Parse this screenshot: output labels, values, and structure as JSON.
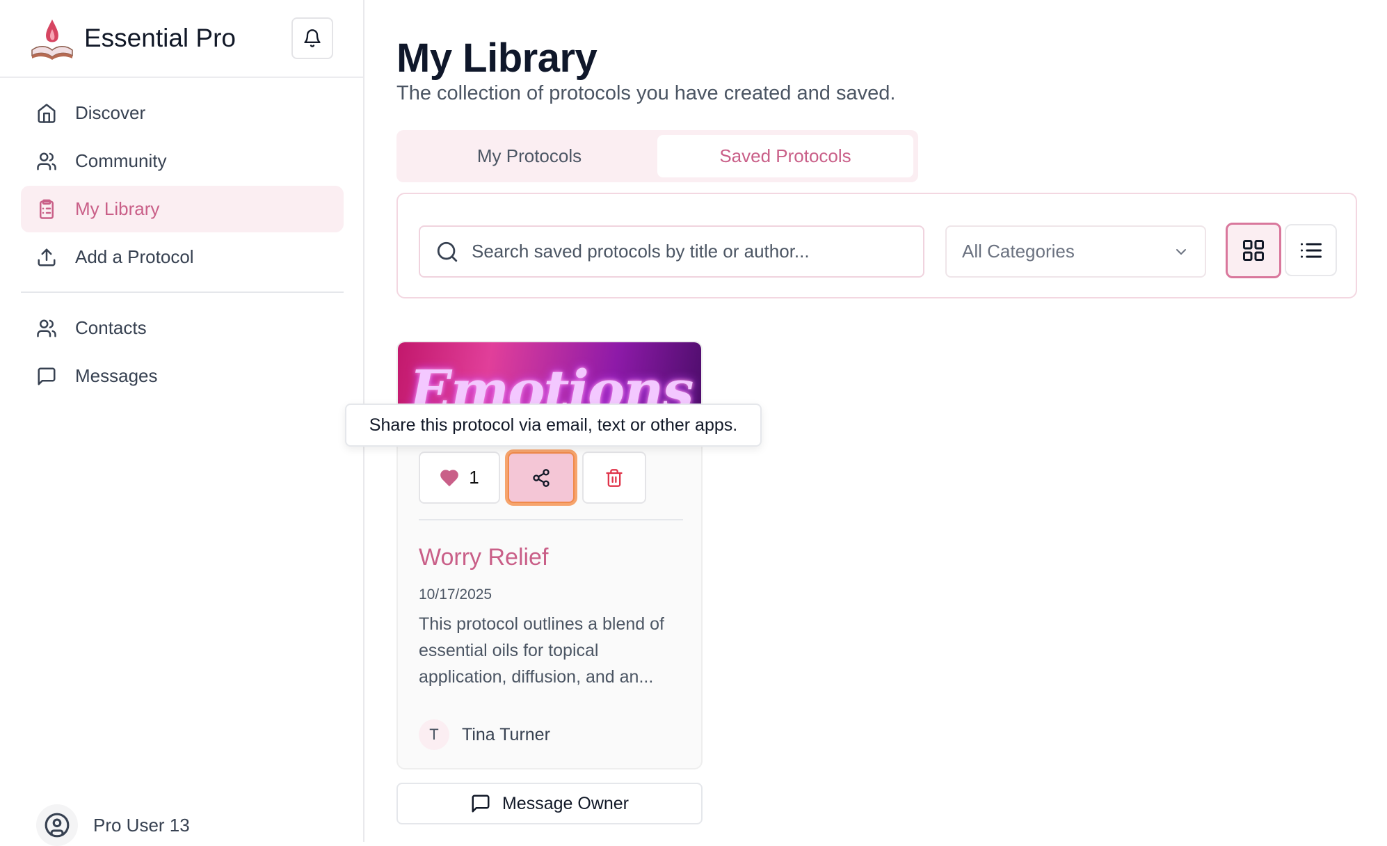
{
  "app": {
    "name": "Essential Pro"
  },
  "sidebar": {
    "items": [
      {
        "label": "Discover",
        "icon": "home-icon"
      },
      {
        "label": "Community",
        "icon": "users-icon"
      },
      {
        "label": "My Library",
        "icon": "clipboard-list-icon",
        "active": true
      },
      {
        "label": "Add a Protocol",
        "icon": "upload-icon"
      },
      {
        "label": "Contacts",
        "icon": "users-icon"
      },
      {
        "label": "Messages",
        "icon": "message-square-icon"
      }
    ],
    "user": "Pro User 13"
  },
  "page": {
    "title": "My Library",
    "subtitle": "The collection of protocols you have created and saved."
  },
  "tabs": [
    {
      "label": "My Protocols",
      "active": false
    },
    {
      "label": "Saved Protocols",
      "active": true
    }
  ],
  "filters": {
    "search_placeholder": "Search saved protocols by title or author...",
    "category": "All Categories",
    "view_mode": "grid"
  },
  "card": {
    "banner_text": "Emotions",
    "likes": "1",
    "title": "Worry Relief",
    "date": "10/17/2025",
    "description": "This protocol outlines a blend of essential oils for topical application, diffusion, and an...",
    "author_initial": "T",
    "author": "Tina Turner"
  },
  "tooltip": "Share this protocol via email, text or other apps.",
  "message_owner_label": "Message Owner",
  "colors": {
    "accent": "#c95f88",
    "accent_bg": "#fbeef2",
    "share_bg": "#f4c6d6",
    "focus_ring": "#f08a4b",
    "delete": "#e0344a"
  }
}
